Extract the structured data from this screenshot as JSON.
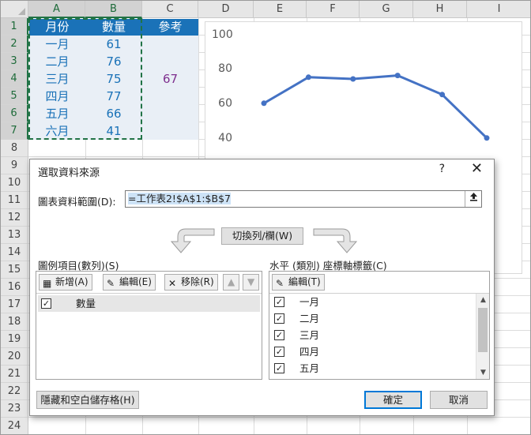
{
  "sheet": {
    "columns": [
      "A",
      "B",
      "C",
      "D",
      "E",
      "F",
      "G",
      "H",
      "I"
    ],
    "rows": [
      "1",
      "2",
      "3",
      "4",
      "5",
      "6",
      "7",
      "8",
      "9",
      "10",
      "11",
      "12",
      "13",
      "14",
      "15",
      "16",
      "17",
      "18",
      "19",
      "20",
      "21",
      "22",
      "23",
      "24"
    ],
    "header_a": "月份",
    "header_b": "數量",
    "header_c": "參考",
    "months": [
      "一月",
      "二月",
      "三月",
      "四月",
      "五月",
      "六月"
    ],
    "values": [
      "61",
      "76",
      "75",
      "77",
      "66",
      "41"
    ],
    "reference_value": "67",
    "colors": {
      "header_fill": "#1a72b8",
      "data_fill": "#e9eff6",
      "text_blue": "#1a72b8",
      "text_purple": "#7e2f8e",
      "selection_green": "#217346"
    }
  },
  "chart": {
    "yticks": [
      "100",
      "80",
      "60",
      "40"
    ]
  },
  "chart_data": {
    "type": "line",
    "categories": [
      "一月",
      "二月",
      "三月",
      "四月",
      "五月",
      "六月"
    ],
    "series": [
      {
        "name": "數量",
        "values": [
          61,
          76,
          75,
          77,
          66,
          41
        ],
        "color": "#4472c4"
      }
    ],
    "ylim": [
      40,
      100
    ],
    "ytick_labels": [
      "100",
      "80",
      "60",
      "40"
    ],
    "grid": false
  },
  "dialog": {
    "title": "選取資料來源",
    "help": "?",
    "close": "✕",
    "range_label": "圖表資料範圍(D):",
    "range_value": "=工作表2!$A$1:$B$7",
    "switch_button": "切換列/欄(W)",
    "legend_panel_title": "圖例項目(數列)(S)",
    "axis_panel_title": "水平 (類別) 座標軸標籤(C)",
    "add_button": "新增(A)",
    "edit_button": "編輯(E)",
    "remove_button": "移除(R)",
    "move_up": "▲",
    "move_down": "▼",
    "axis_edit_button": "編輯(T)",
    "series_items": [
      "數量"
    ],
    "axis_items": [
      "一月",
      "二月",
      "三月",
      "四月",
      "五月"
    ],
    "hidden_cells_button": "隱藏和空白儲存格(H)",
    "ok_button": "確定",
    "cancel_button": "取消"
  }
}
